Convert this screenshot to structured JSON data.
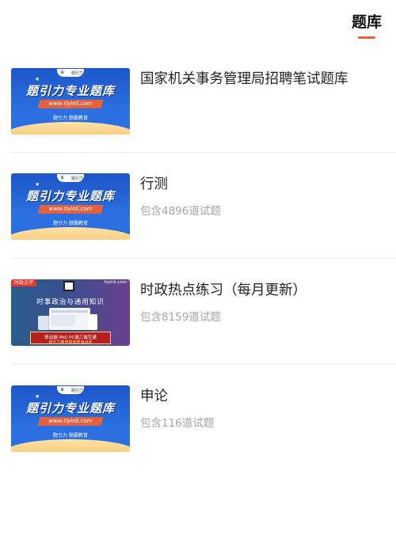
{
  "header": {
    "tab_label": "题库",
    "accent_color": "#e8603a"
  },
  "items": [
    {
      "title": "国家机关事务管理局招聘笔试题库",
      "count": "",
      "thumbnail": {
        "style": "blue",
        "logo_text": "题引力",
        "headline": "题引力专业题库",
        "url": "www.tiyinli.com",
        "sub": "题引力 题霸教育"
      }
    },
    {
      "title": "行测",
      "count": "包含4896道试题",
      "thumbnail": {
        "style": "blue",
        "logo_text": "题引力",
        "headline": "题引力专业题库",
        "url": "www.tiyinli.com",
        "sub": "题引力 题霸教育"
      }
    },
    {
      "title": "时政热点练习（每月更新）",
      "count": "包含8159道试题",
      "thumbnail": {
        "style": "purple",
        "tag": "时政点评",
        "site": "tiyinli.com",
        "headline": "时事政治与通用知识",
        "banner_line1": "移动端 PAD PC端三端互通",
        "banner_line2": "题引力教育题库题海战术"
      }
    },
    {
      "title": "申论",
      "count": "包含116道试题",
      "thumbnail": {
        "style": "blue",
        "logo_text": "题引力",
        "headline": "题引力专业题库",
        "url": "www.tiyinli.com",
        "sub": "题引力 题霸教育"
      }
    }
  ]
}
